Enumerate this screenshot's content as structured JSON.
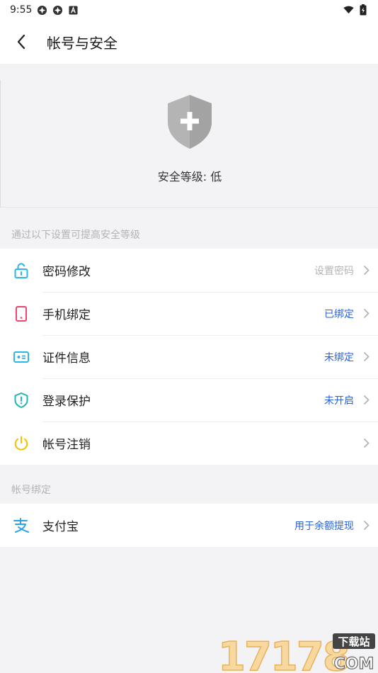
{
  "status_bar": {
    "time": "9:55",
    "icons": [
      "gear-notification-icon",
      "gear-notification-icon",
      "a-notification-icon"
    ],
    "right_icons": [
      "wifi-icon",
      "battery-charging-icon"
    ]
  },
  "app_bar": {
    "back_icon": "chevron-left-icon",
    "title": "帐号与安全"
  },
  "security": {
    "shield_icon": "shield-plus-icon",
    "level_text": "安全等级: 低"
  },
  "section_security": {
    "label": "通过以下设置可提高安全等级",
    "items": [
      {
        "icon": "unlock-icon",
        "icon_color": "#29b6e8",
        "label": "密码修改",
        "status": "设置密码",
        "status_color": "gray"
      },
      {
        "icon": "phone-icon",
        "icon_color": "#f0466e",
        "label": "手机绑定",
        "status": "已绑定",
        "status_color": "blue"
      },
      {
        "icon": "id-card-icon",
        "icon_color": "#29b6e8",
        "label": "证件信息",
        "status": "未绑定",
        "status_color": "blue"
      },
      {
        "icon": "shield-alert-icon",
        "icon_color": "#1fb8b0",
        "label": "登录保护",
        "status": "未开启",
        "status_color": "blue"
      },
      {
        "icon": "power-icon",
        "icon_color": "#f5c000",
        "label": "帐号注销",
        "status": "",
        "status_color": "gray"
      }
    ]
  },
  "section_binding": {
    "label": "帐号绑定",
    "items": [
      {
        "icon": "alipay-icon",
        "icon_color": "#29a3e8",
        "label": "支付宝",
        "status": "用于余额提现",
        "status_color": "blue"
      }
    ]
  },
  "colors": {
    "accent_blue": "#2a62d9",
    "background": "#f3f3f5",
    "shield_gray": "#b8b8b8"
  },
  "watermark": {
    "main": "17178",
    "sub_top": "下载站",
    "sub_bottom": "COM"
  }
}
